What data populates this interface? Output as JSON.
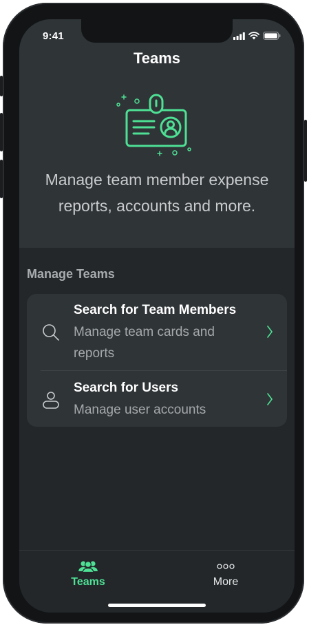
{
  "status_bar": {
    "time": "9:41"
  },
  "header": {
    "title": "Teams"
  },
  "hero": {
    "icon": "id-badge-icon",
    "text": "Manage team member expense reports, accounts and more."
  },
  "manage_teams": {
    "section_label": "Manage Teams",
    "items": [
      {
        "icon": "search-icon",
        "title": "Search for Team Members",
        "subtitle": "Manage team cards and reports"
      },
      {
        "icon": "user-icon",
        "title": "Search for Users",
        "subtitle": "Manage user accounts"
      }
    ]
  },
  "tab_bar": {
    "tabs": [
      {
        "label": "Teams",
        "icon": "team-icon",
        "active": true
      },
      {
        "label": "More",
        "icon": "more-icon",
        "active": false
      }
    ]
  },
  "colors": {
    "accent": "#4ee094",
    "background": "#23272a",
    "hero_background": "#2f3437",
    "card_background": "#2f3437"
  }
}
